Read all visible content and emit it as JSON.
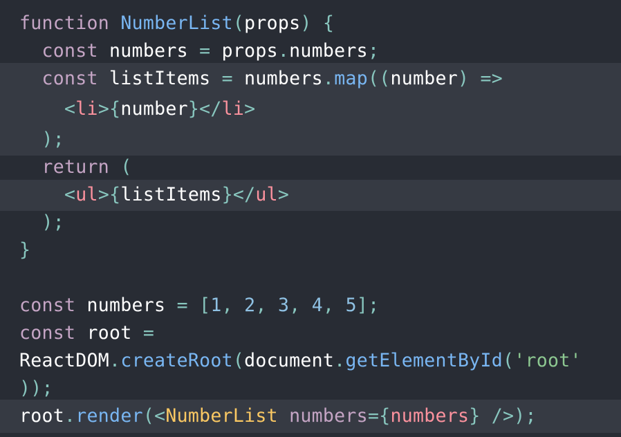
{
  "code_lines": [
    [
      [
        "kw",
        "function"
      ],
      [
        "pl",
        " "
      ],
      [
        "fn",
        "NumberList"
      ],
      [
        "pu",
        "("
      ],
      [
        "pl",
        "props"
      ],
      [
        "pu",
        ")"
      ],
      [
        "pl",
        " "
      ],
      [
        "pu",
        "{"
      ]
    ],
    [
      [
        "pl",
        "  "
      ],
      [
        "kw",
        "const"
      ],
      [
        "pl",
        " numbers "
      ],
      [
        "pu",
        "="
      ],
      [
        "pl",
        " props"
      ],
      [
        "pu",
        "."
      ],
      [
        "pl",
        "numbers"
      ],
      [
        "pu",
        ";"
      ]
    ],
    [
      [
        "pl",
        "  "
      ],
      [
        "kw",
        "const"
      ],
      [
        "pl",
        " listItems "
      ],
      [
        "pu",
        "="
      ],
      [
        "pl",
        " numbers"
      ],
      [
        "pu",
        "."
      ],
      [
        "fn",
        "map"
      ],
      [
        "pu",
        "(("
      ],
      [
        "pl",
        "number"
      ],
      [
        "pu",
        ")"
      ],
      [
        "pl",
        " "
      ],
      [
        "pu",
        "=>"
      ]
    ],
    [
      [
        "pl",
        "    "
      ],
      [
        "pu",
        "<"
      ],
      [
        "tag",
        "li"
      ],
      [
        "pu",
        ">{"
      ],
      [
        "pl",
        "number"
      ],
      [
        "pu",
        "}</"
      ],
      [
        "tag",
        "li"
      ],
      [
        "pu",
        ">"
      ]
    ],
    [
      [
        "pl",
        "  "
      ],
      [
        "pu",
        ");"
      ]
    ],
    [
      [
        "pl",
        "  "
      ],
      [
        "kw",
        "return"
      ],
      [
        "pl",
        " "
      ],
      [
        "pu",
        "("
      ]
    ],
    [
      [
        "pl",
        "    "
      ],
      [
        "pu",
        "<"
      ],
      [
        "tag",
        "ul"
      ],
      [
        "pu",
        ">{"
      ],
      [
        "pl",
        "listItems"
      ],
      [
        "pu",
        "}</"
      ],
      [
        "tag",
        "ul"
      ],
      [
        "pu",
        ">"
      ]
    ],
    [
      [
        "pl",
        "  "
      ],
      [
        "pu",
        ");"
      ]
    ],
    [
      [
        "pu",
        "}"
      ]
    ],
    [],
    [
      [
        "kw",
        "const"
      ],
      [
        "pl",
        " numbers "
      ],
      [
        "pu",
        "="
      ],
      [
        "pl",
        " "
      ],
      [
        "pu",
        "["
      ],
      [
        "num",
        "1"
      ],
      [
        "pu",
        ","
      ],
      [
        "pl",
        " "
      ],
      [
        "num",
        "2"
      ],
      [
        "pu",
        ","
      ],
      [
        "pl",
        " "
      ],
      [
        "num",
        "3"
      ],
      [
        "pu",
        ","
      ],
      [
        "pl",
        " "
      ],
      [
        "num",
        "4"
      ],
      [
        "pu",
        ","
      ],
      [
        "pl",
        " "
      ],
      [
        "num",
        "5"
      ],
      [
        "pu",
        "];"
      ]
    ],
    [
      [
        "kw",
        "const"
      ],
      [
        "pl",
        " root "
      ],
      [
        "pu",
        "="
      ]
    ],
    [
      [
        "pl",
        "ReactDOM"
      ],
      [
        "pu",
        "."
      ],
      [
        "fn",
        "createRoot"
      ],
      [
        "pu",
        "("
      ],
      [
        "pl",
        "document"
      ],
      [
        "pu",
        "."
      ],
      [
        "fn",
        "getElementById"
      ],
      [
        "pu",
        "("
      ],
      [
        "str",
        "'root'"
      ]
    ],
    [
      [
        "pu",
        "));"
      ]
    ],
    [
      [
        "pl",
        "root"
      ],
      [
        "pu",
        "."
      ],
      [
        "fn",
        "render"
      ],
      [
        "pu",
        "(<"
      ],
      [
        "cmp",
        "NumberList"
      ],
      [
        "pl",
        " "
      ],
      [
        "kw",
        "numbers"
      ],
      [
        "pu",
        "={"
      ],
      [
        "tag",
        "numbers"
      ],
      [
        "pu",
        "}"
      ],
      [
        "pl",
        " "
      ],
      [
        "pu",
        "/>);"
      ]
    ]
  ],
  "colors": {
    "background": "#282c34",
    "highlight": "#363a43",
    "keyword": "#c5a5c5",
    "function": "#79b6f2",
    "tag": "#fc929e",
    "number": "#8fc1e3",
    "string": "#8dc891",
    "component": "#fac863",
    "punctuation": "#88c6be"
  }
}
